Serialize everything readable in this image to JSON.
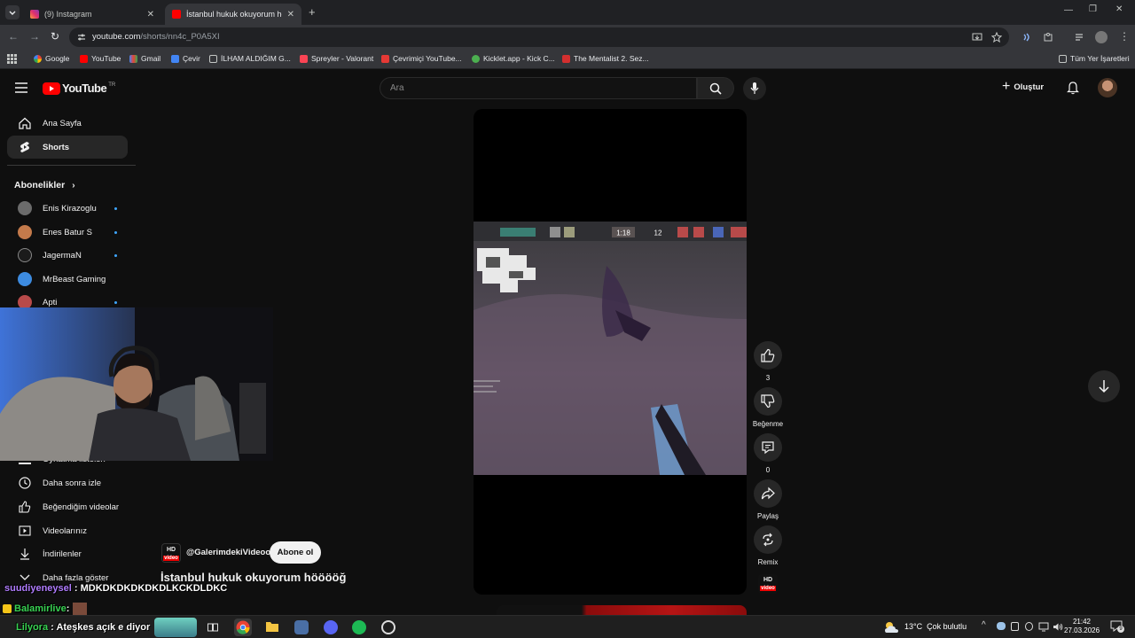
{
  "browser": {
    "tabs": [
      {
        "title": "(9) Instagram",
        "favicon": "instagram-icon"
      },
      {
        "title": "İstanbul hukuk okuyorum höö",
        "favicon": "youtube-icon"
      }
    ],
    "url_host": "youtube.com",
    "url_path": "/shorts/nn4c_P0A5XI",
    "bookmarks": [
      "Google",
      "YouTube",
      "Gmail",
      "Çevir",
      "İLHAM ALDIĞIM G...",
      "Spreyler - Valorant",
      "Çevrimiçi YouTube...",
      "Kicklet.app - Kick C...",
      "The Mentalist 2. Sez..."
    ],
    "all_bookmarks": "Tüm Yer İşaretleri"
  },
  "youtube": {
    "logo": "YouTube",
    "logo_region": "TR",
    "search_placeholder": "Ara",
    "create_label": "Oluştur",
    "sidebar": {
      "home": "Ana Sayfa",
      "shorts": "Shorts",
      "subscriptions_header": "Abonelikler",
      "subscriptions": [
        "Enis Kirazoglu",
        "Enes Batur S",
        "JagermaN",
        "MrBeast Gaming",
        "Apti"
      ],
      "playlists_partial": "Oynatma listeleri",
      "watch_later": "Daha sonra izle",
      "liked": "Beğendiğim videolar",
      "your_videos": "Videolarınız",
      "downloads": "İndirilenler",
      "show_more": "Daha fazla göster"
    },
    "short": {
      "channel": "@GalerimdekiVideoo",
      "subscribe": "Abone ol",
      "title": "İstanbul hukuk okuyorum hööööğ",
      "likes": "3",
      "dislike_label": "Beğenme",
      "comments": "0",
      "share_label": "Paylaş",
      "remix_label": "Remix",
      "hud_timer": "1:18",
      "hud_score": "12"
    }
  },
  "stream_overlay": {
    "chat": [
      {
        "user": "suudiyeneysel",
        "message": "MDKDKDKDKDKDLKCKDLDKC",
        "color": "#b07cff"
      },
      {
        "user": "Balamirlive",
        "message": "",
        "color": "#39d353"
      },
      {
        "user": "Lilyora",
        "message": "Ateşkes açık e diyor",
        "color": "#39d353"
      }
    ]
  },
  "taskbar": {
    "weather": "13°C  Çok bulutlu",
    "time": "21:42",
    "date": "27.03.2026",
    "notif_count": "9"
  }
}
